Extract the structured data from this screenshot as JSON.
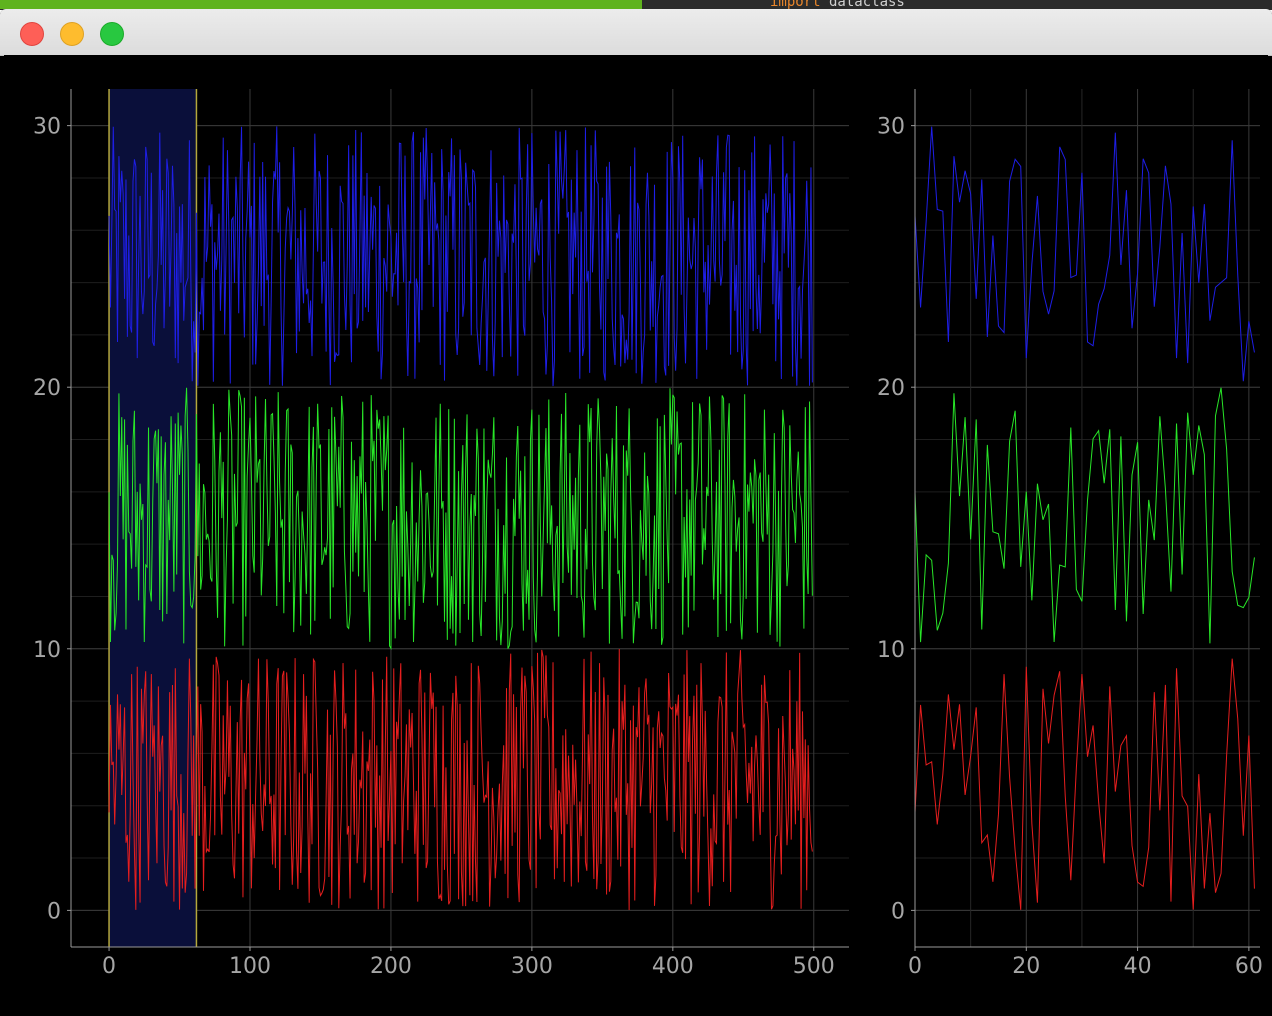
{
  "desktop": {
    "code_kw": "import",
    "code_rest": " dataclass"
  },
  "window": {
    "controls": [
      "close",
      "minimize",
      "maximize"
    ]
  },
  "colors": {
    "background": "#000000",
    "grid": "#3a3a3a",
    "axis": "#9a9a9a",
    "tick_label": "#a6a6a6",
    "series_top": "#1e1ee6",
    "series_mid": "#28e628",
    "series_bottom": "#e61e1e",
    "region_fill": "#0a0f3a",
    "region_edge": "#b4a83c"
  },
  "chart_data": [
    {
      "type": "line",
      "title": "",
      "xlabel": "",
      "ylabel": "",
      "xlim": [
        -27,
        525
      ],
      "ylim": [
        -1.4,
        31.4
      ],
      "xticks": [
        0,
        100,
        200,
        300,
        400,
        500
      ],
      "yticks": [
        0,
        10,
        20,
        30
      ],
      "grid": true,
      "n_points": 500,
      "series": [
        {
          "range": [
            20,
            30
          ]
        },
        {
          "range": [
            10,
            20
          ]
        },
        {
          "range": [
            0,
            10
          ]
        }
      ],
      "region": {
        "x": [
          0,
          62
        ]
      }
    },
    {
      "type": "line",
      "title": "",
      "xlabel": "",
      "ylabel": "",
      "xlim": [
        0,
        62
      ],
      "ylim": [
        -1.4,
        31.4
      ],
      "xticks": [
        0,
        20,
        40,
        60
      ],
      "yticks": [
        0,
        10,
        20,
        30
      ],
      "grid": true,
      "n_points": 62,
      "series": [
        {
          "range": [
            20,
            30
          ]
        },
        {
          "range": [
            10,
            20
          ]
        },
        {
          "range": [
            0,
            10
          ]
        }
      ]
    }
  ],
  "tick_labels": {
    "main_x": [
      "0",
      "100",
      "200",
      "300",
      "400",
      "500"
    ],
    "main_y": [
      "0",
      "10",
      "20",
      "30"
    ],
    "zoom_x": [
      "0",
      "20",
      "40",
      "60"
    ],
    "zoom_y": [
      "0",
      "10",
      "20",
      "30"
    ]
  }
}
